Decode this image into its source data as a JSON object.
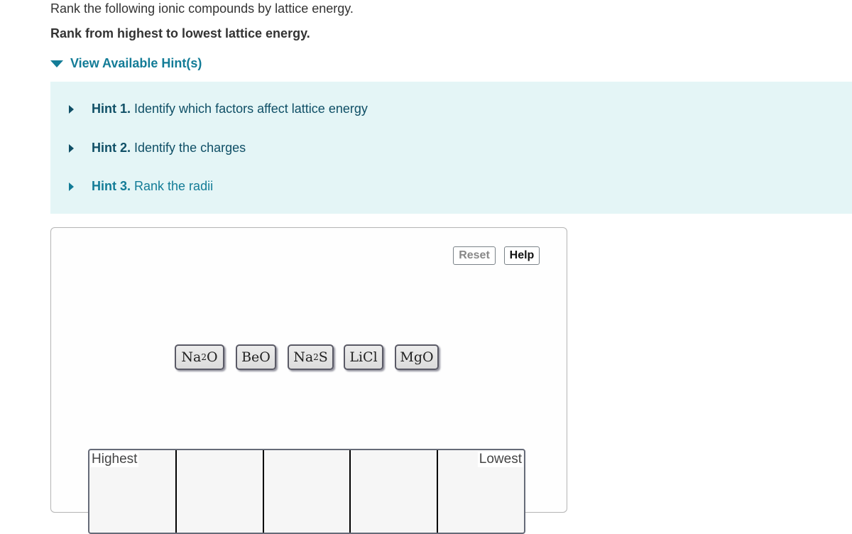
{
  "question": {
    "prompt": "Rank the following ionic compounds by lattice energy.",
    "instruction": "Rank from highest to lowest lattice energy."
  },
  "hints": {
    "toggle_label": "View Available Hint(s)",
    "items": [
      {
        "label": "Hint 1.",
        "text": "Identify which factors affect lattice energy"
      },
      {
        "label": "Hint 2.",
        "text": "Identify the charges"
      },
      {
        "label": "Hint 3.",
        "text": "Rank the radii"
      }
    ]
  },
  "ranking": {
    "reset_label": "Reset",
    "help_label": "Help",
    "tiles": [
      {
        "base": "Na",
        "sub": "2",
        "rest": "O"
      },
      {
        "base": "BeO",
        "sub": "",
        "rest": ""
      },
      {
        "base": "Na",
        "sub": "2",
        "rest": "S"
      },
      {
        "base": "LiCl",
        "sub": "",
        "rest": ""
      },
      {
        "base": "MgO",
        "sub": "",
        "rest": ""
      }
    ],
    "highest_label": "Highest",
    "lowest_label": "Lowest"
  },
  "colors": {
    "link": "#137c97",
    "hint_bg": "#e4f5f6"
  }
}
